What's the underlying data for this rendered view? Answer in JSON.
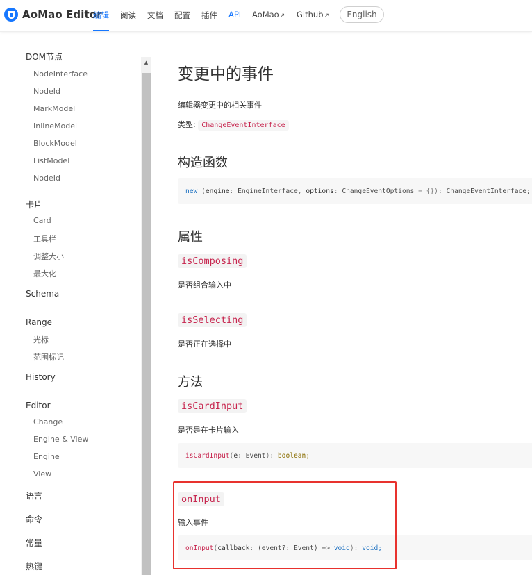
{
  "header": {
    "brand": "AoMao Editor",
    "nav": {
      "editor": "编辑",
      "read": "阅读",
      "docs": "文档",
      "config": "配置",
      "plugins": "插件",
      "api": "API",
      "aomao": "AoMao",
      "github": "Github"
    },
    "lang_button": "English",
    "accent_color": "#1677ff"
  },
  "sidebar": {
    "dom_group": "DOM节点",
    "dom_items": [
      "NodeInterface",
      "NodeId",
      "MarkModel",
      "InlineModel",
      "BlockModel",
      "ListModel",
      "NodeId"
    ],
    "card_group": "卡片",
    "card_items": [
      "Card",
      "工具栏",
      "调整大小",
      "最大化"
    ],
    "schema": "Schema",
    "range_group": "Range",
    "range_items": [
      "光标",
      "范围标记"
    ],
    "history": "History",
    "editor_group": "Editor",
    "editor_items": [
      "Change",
      "Engine & View",
      "Engine",
      "View"
    ],
    "language": "语言",
    "command": "命令",
    "constants": "常量",
    "hotkeys": "热键"
  },
  "main": {
    "title": "变更中的事件",
    "description": "编辑器变更中的相关事件",
    "type_label": "类型:",
    "type_value": "ChangeEventInterface",
    "constructor_heading": "构造函数",
    "constructor_sig": {
      "new": "new",
      "open": "(",
      "p1": "engine",
      "t1": "EngineInterface",
      "comma": ",",
      "p2": "options",
      "t2": "ChangeEventOptions",
      "default": "= {}",
      "close": "):",
      "ret": "ChangeEventInterface;"
    },
    "props_heading": "属性",
    "props": [
      {
        "name": "isComposing",
        "desc": "是否组合输入中"
      },
      {
        "name": "isSelecting",
        "desc": "是否正在选择中"
      }
    ],
    "methods_heading": "方法",
    "methods": [
      {
        "name": "isCardInput",
        "desc": "是否是在卡片输入",
        "sig": {
          "fn": "isCardInput",
          "open": "(",
          "param": "e",
          "colon": ":",
          "ptype": "Event",
          "close": "):",
          "ret": "boolean;"
        }
      },
      {
        "name": "onInput",
        "desc": "输入事件",
        "sig": {
          "fn": "onInput",
          "open": "(",
          "param": "callback",
          "colon": ":",
          "inner": "(event?: Event) =>",
          "void1": "void",
          "close": "):",
          "ret": "void;"
        }
      }
    ]
  },
  "colors": {
    "highlight_border": "#e8322e",
    "code_red": "#c7254e"
  }
}
